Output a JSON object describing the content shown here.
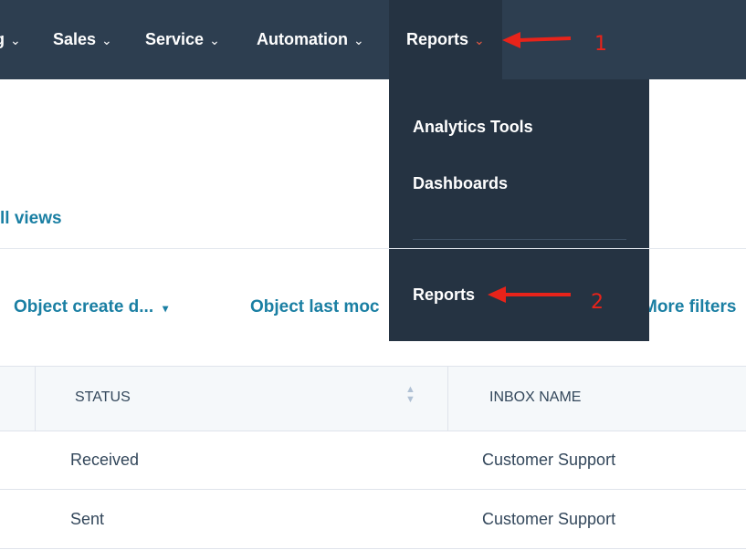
{
  "topnav": {
    "items": [
      {
        "label": "g",
        "chev": "⌄"
      },
      {
        "label": "Sales",
        "chev": "⌄"
      },
      {
        "label": "Service",
        "chev": "⌄"
      },
      {
        "label": "Automation",
        "chev": "⌄"
      },
      {
        "label": "Reports",
        "chev": "⌄"
      }
    ]
  },
  "dropdown": {
    "items": [
      "Analytics Tools",
      "Dashboards",
      "Reports"
    ]
  },
  "views_link": "ll views",
  "filters": {
    "object_create": "Object create d...",
    "object_create_caret": "▾",
    "object_last_mod": "Object last moc",
    "more_filters": "More filters"
  },
  "table": {
    "headers": [
      "STATUS",
      "INBOX NAME"
    ],
    "rows": [
      {
        "status": "Received",
        "inbox": "Customer Support"
      },
      {
        "status": "Sent",
        "inbox": "Customer Support"
      }
    ]
  },
  "annotations": {
    "step1": "1",
    "step2": "2"
  },
  "colors": {
    "nav_bg": "#2d3e50",
    "dropdown_bg": "#253342",
    "link": "#1a7fa3",
    "annotation": "#e8231a"
  }
}
